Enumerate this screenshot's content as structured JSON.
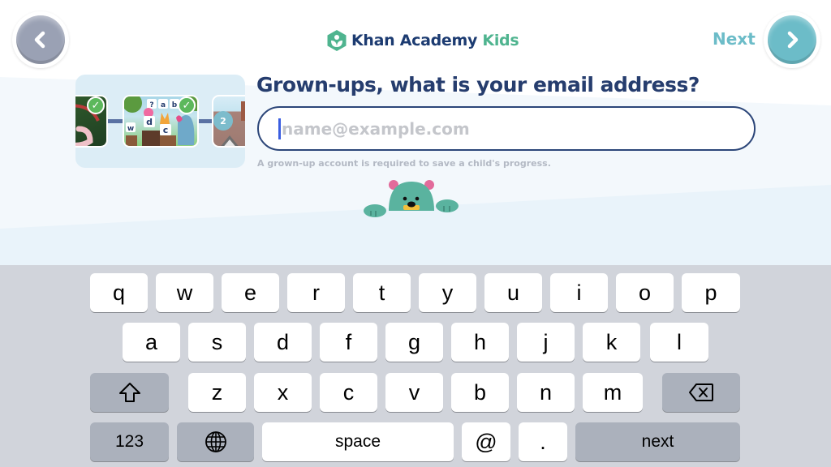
{
  "header": {
    "back_icon": "chevron-left-icon",
    "logo_icon": "khan-academy-hexagon-icon",
    "logo_text": "Khan Academy",
    "logo_kids": "Kids",
    "next_label": "Next",
    "next_icon": "chevron-right-icon"
  },
  "progress": {
    "completed_check": "✓",
    "next_level_number": "2",
    "thumb_letters": [
      "?",
      "a",
      "b",
      "d",
      "w",
      "c"
    ]
  },
  "form": {
    "question": "Grown-ups, what is your email address?",
    "email_value": "",
    "email_placeholder": "name@example.com",
    "helper_text": "A grown-up account is required to save a child's progress."
  },
  "keyboard": {
    "row1": [
      "q",
      "w",
      "e",
      "r",
      "t",
      "y",
      "u",
      "i",
      "o",
      "p"
    ],
    "row2": [
      "a",
      "s",
      "d",
      "f",
      "g",
      "h",
      "j",
      "k",
      "l"
    ],
    "row3": [
      "z",
      "x",
      "c",
      "v",
      "b",
      "n",
      "m"
    ],
    "shift_icon": "shift-icon",
    "backspace_icon": "backspace-icon",
    "numbers_label": "123",
    "globe_icon": "globe-icon",
    "space_label": "space",
    "at_label": "@",
    "period_label": ".",
    "return_label": "next"
  },
  "colors": {
    "title_navy": "#263d6e",
    "brand_green": "#4fb48f",
    "next_teal": "#6cbcc8",
    "back_grey": "#9aa1b4",
    "caret_blue": "#3b5ee0",
    "keyboard_bg": "#d1d4db"
  }
}
